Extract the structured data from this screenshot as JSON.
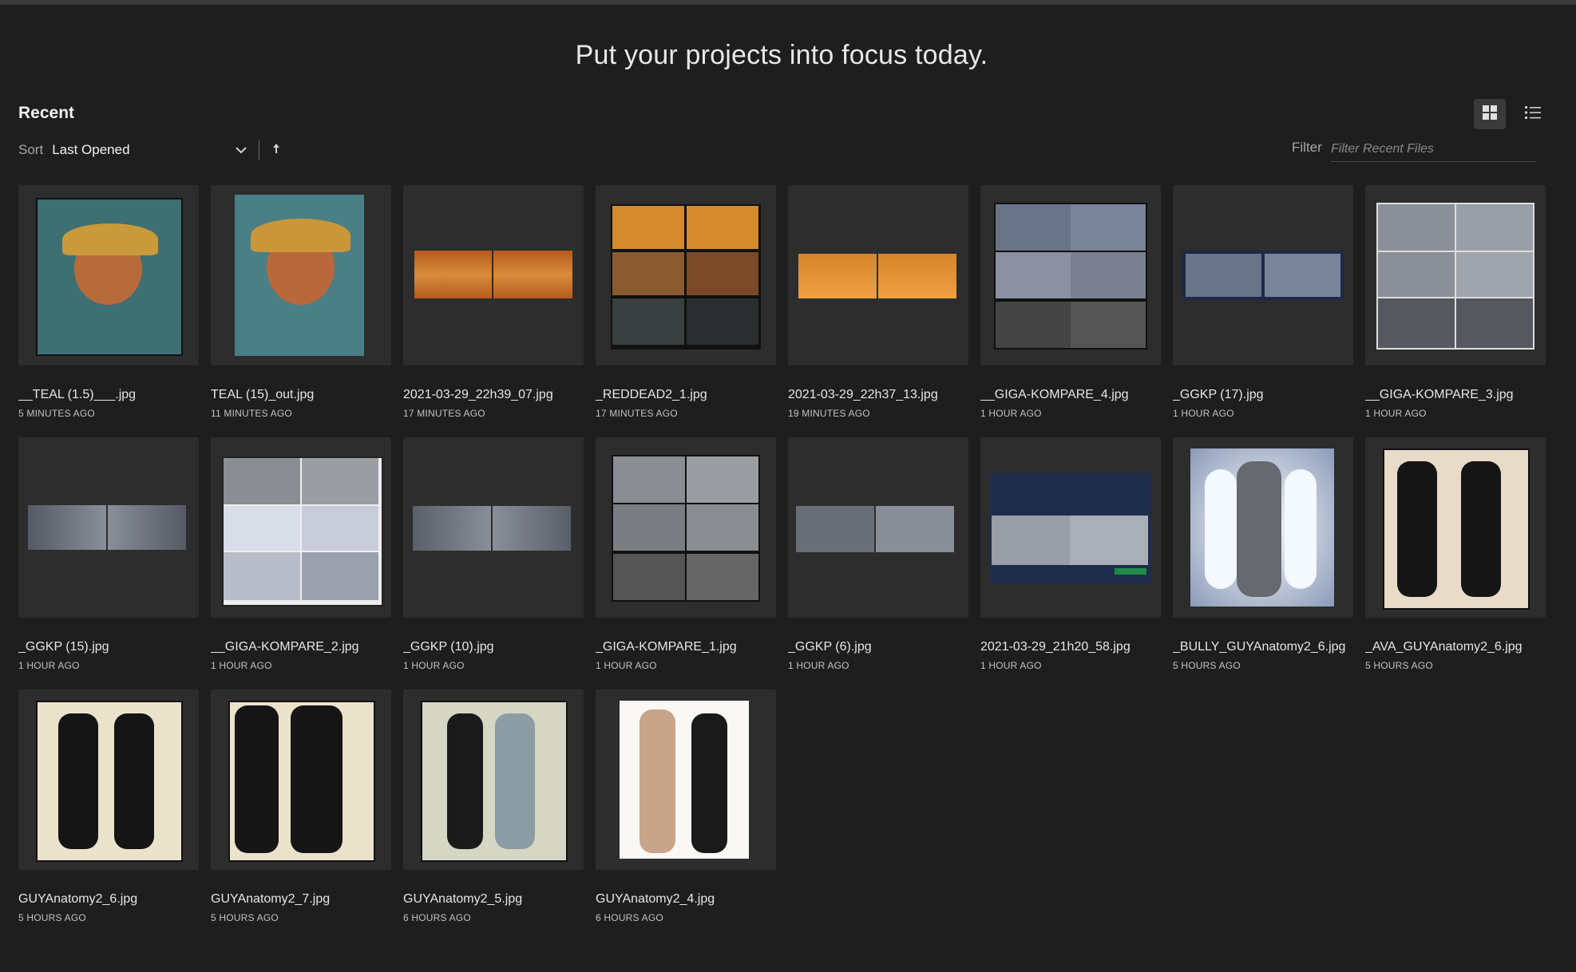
{
  "header": {
    "headline": "Put your projects into focus today.",
    "section_title": "Recent"
  },
  "sort": {
    "label": "Sort",
    "value": "Last Opened",
    "direction_icon": "arrow-up-icon"
  },
  "filter": {
    "label": "Filter",
    "placeholder": "Filter Recent Files"
  },
  "view_toggle": {
    "active": "grid",
    "grid_icon": "grid-view-icon",
    "list_icon": "list-view-icon"
  },
  "colors": {
    "background": "#1e1e1e",
    "card": "#2d2d2d",
    "active_toggle": "#3a3a3a"
  },
  "files": [
    {
      "name": "__TEAL (1.5)___.jpg",
      "time": "5 MINUTES AGO"
    },
    {
      "name": "TEAL (15)_out.jpg",
      "time": "11 MINUTES AGO"
    },
    {
      "name": "2021-03-29_22h39_07.jpg",
      "time": "17 MINUTES AGO"
    },
    {
      "name": "_REDDEAD2_1.jpg",
      "time": "17 MINUTES AGO"
    },
    {
      "name": "2021-03-29_22h37_13.jpg",
      "time": "19 MINUTES AGO"
    },
    {
      "name": "__GIGA-KOMPARE_4.jpg",
      "time": "1 HOUR AGO"
    },
    {
      "name": "_GGKP (17).jpg",
      "time": "1 HOUR AGO"
    },
    {
      "name": "__GIGA-KOMPARE_3.jpg",
      "time": "1 HOUR AGO"
    },
    {
      "name": "_GGKP (15).jpg",
      "time": "1 HOUR AGO"
    },
    {
      "name": "__GIGA-KOMPARE_2.jpg",
      "time": "1 HOUR AGO"
    },
    {
      "name": "_GGKP (10).jpg",
      "time": "1 HOUR AGO"
    },
    {
      "name": "_GIGA-KOMPARE_1.jpg",
      "time": "1 HOUR AGO"
    },
    {
      "name": "_GGKP (6).jpg",
      "time": "1 HOUR AGO"
    },
    {
      "name": "2021-03-29_21h20_58.jpg",
      "time": "1 HOUR AGO"
    },
    {
      "name": "_BULLY_GUYAnatomy2_6.jpg",
      "time": "5 HOURS AGO"
    },
    {
      "name": "_AVA_GUYAnatomy2_6.jpg",
      "time": "5 HOURS AGO"
    },
    {
      "name": "GUYAnatomy2_6.jpg",
      "time": "5 HOURS AGO"
    },
    {
      "name": "GUYAnatomy2_7.jpg",
      "time": "5 HOURS AGO"
    },
    {
      "name": "GUYAnatomy2_5.jpg",
      "time": "6 HOURS AGO"
    },
    {
      "name": "GUYAnatomy2_4.jpg",
      "time": "6 HOURS AGO"
    }
  ]
}
